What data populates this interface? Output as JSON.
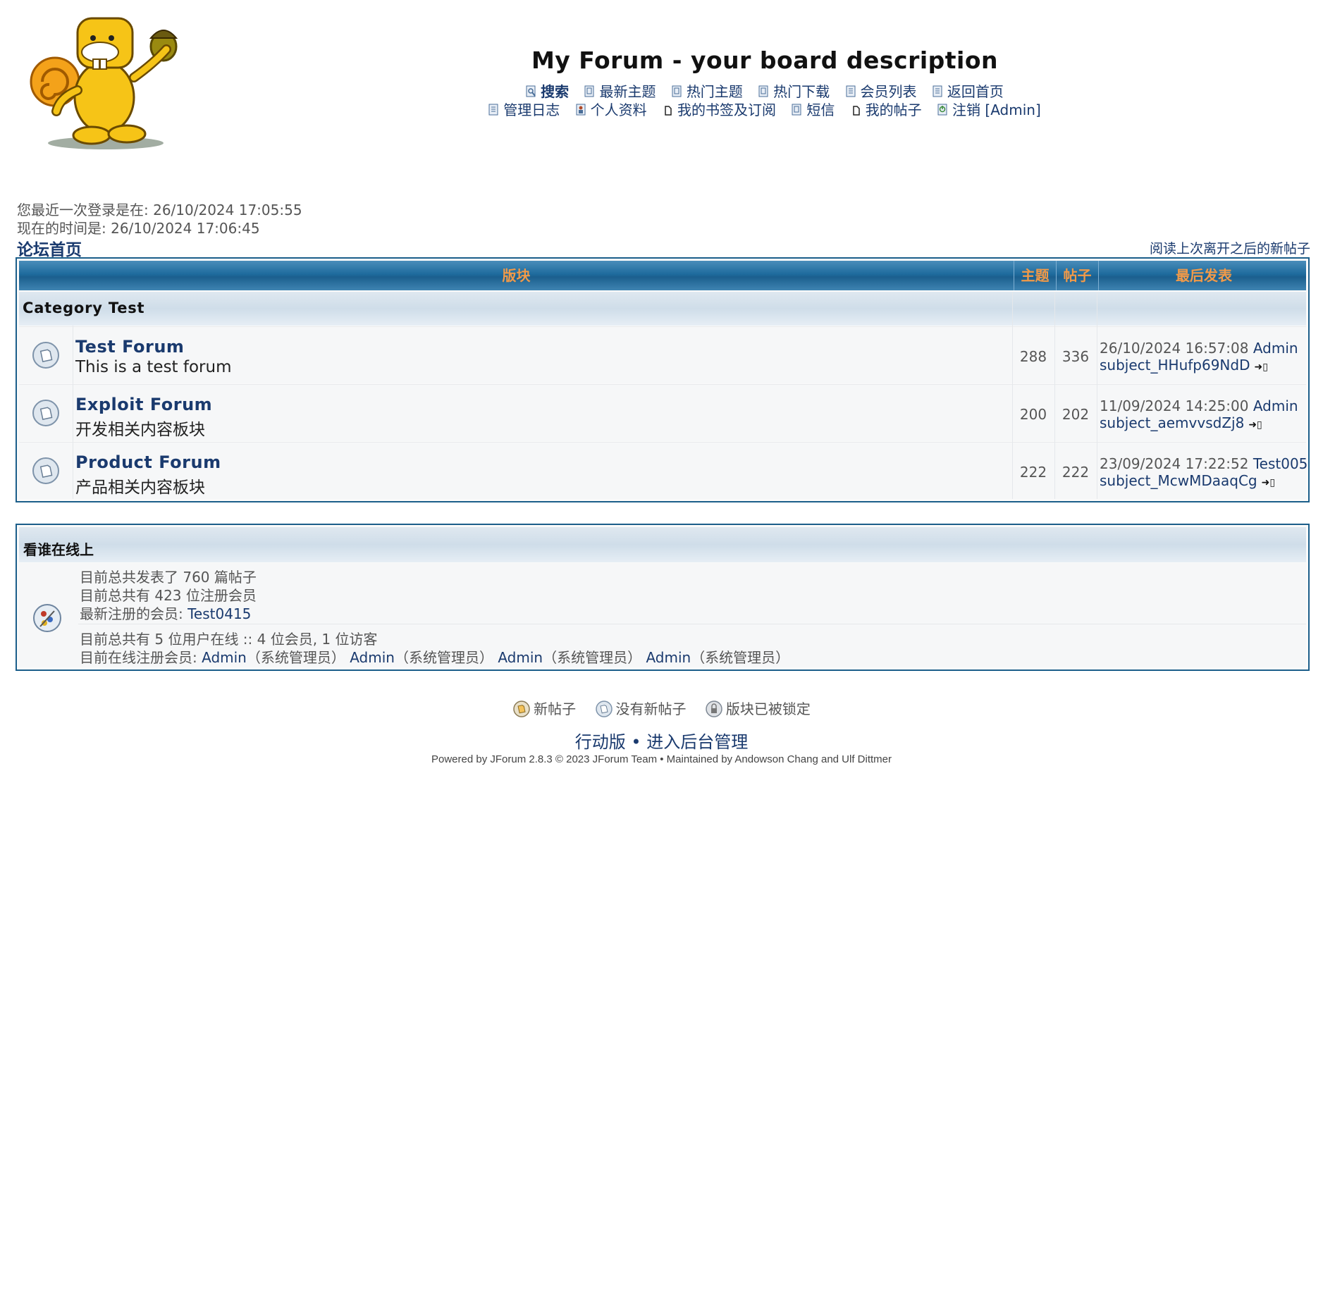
{
  "site": {
    "title": "My Forum - your board description",
    "logo_icon": "squirrel-logo-icon"
  },
  "nav": {
    "row1": [
      {
        "label": "搜索",
        "icon": "search-icon",
        "bold": true
      },
      {
        "label": "最新主题",
        "icon": "recent-topics-icon"
      },
      {
        "label": "热门主题",
        "icon": "hot-topics-icon"
      },
      {
        "label": "热门下载",
        "icon": "hot-downloads-icon"
      },
      {
        "label": "会员列表",
        "icon": "member-list-icon"
      },
      {
        "label": "返回首页",
        "icon": "home-icon"
      }
    ],
    "row2": [
      {
        "label": "管理日志",
        "icon": "moderation-log-icon"
      },
      {
        "label": "个人资料",
        "icon": "profile-icon"
      },
      {
        "label": "我的书签及订阅",
        "icon": "bookmarks-icon"
      },
      {
        "label": "短信",
        "icon": "private-messages-icon"
      },
      {
        "label": "我的帖子",
        "icon": "my-posts-icon"
      },
      {
        "label": "注销 [Admin]",
        "icon": "logout-icon"
      }
    ]
  },
  "session": {
    "last_visit": "您最近一次登录是在: 26/10/2024 17:05:55",
    "current_time": "现在的时间是: 26/10/2024 17:06:45"
  },
  "breadcrumb": "论坛首页",
  "since_last_visit_link": "阅读上次离开之后的新帖子",
  "forum_table": {
    "headers": {
      "forum": "版块",
      "topics": "主题",
      "posts": "帖子",
      "last_post": "最后发表"
    },
    "category": "Category Test",
    "forums": [
      {
        "name": "Test Forum",
        "desc": "This is a test forum",
        "topics": "288",
        "posts": "336",
        "last_date": "26/10/2024 16:57:08",
        "last_user": "Admin",
        "last_subject": "subject_HHufp69NdD"
      },
      {
        "name": "Exploit Forum",
        "desc": "开发相关内容板块",
        "topics": "200",
        "posts": "202",
        "last_date": "11/09/2024 14:25:00",
        "last_user": "Admin",
        "last_subject": "subject_aemvvsdZj8"
      },
      {
        "name": "Product Forum",
        "desc": "产品相关内容板块",
        "topics": "222",
        "posts": "222",
        "last_date": "23/09/2024 17:22:52",
        "last_user": "Test005",
        "last_subject": "subject_McwMDaaqCg"
      }
    ]
  },
  "online": {
    "title": "看谁在线上",
    "total_posts_prefix": "目前总共发表了",
    "total_posts": "760",
    "total_posts_suffix": "篇帖子",
    "total_users_prefix": "目前总共有",
    "total_users": "423",
    "total_users_suffix": "位注册会员",
    "newest_label": "最新注册的会员:",
    "newest_user": "Test0415",
    "online_summary": "目前总共有 5 位用户在线 :: 4 位会员, 1 位访客",
    "online_users_label": "目前在线注册会员:",
    "online_users": [
      {
        "name": "Admin",
        "role": "（系统管理员）"
      },
      {
        "name": "Admin",
        "role": "（系统管理员）"
      },
      {
        "name": "Admin",
        "role": "（系统管理员）"
      },
      {
        "name": "Admin",
        "role": "（系统管理员）"
      }
    ]
  },
  "legend": [
    {
      "label": "新帖子",
      "icon": "new-posts-folder-icon"
    },
    {
      "label": "没有新帖子",
      "icon": "no-new-posts-folder-icon"
    },
    {
      "label": "版块已被锁定",
      "icon": "locked-folder-icon"
    }
  ],
  "footer": {
    "mobile": "行动版",
    "sep": "•",
    "admin": "进入后台管理",
    "powered": "Powered by JForum 2.8.3 © 2023 JForum Team • Maintained by Andowson Chang and Ulf Dittmer"
  },
  "colors": {
    "header_bg": "#1b5f8e",
    "header_text": "#f29a48",
    "link": "#1a3a6e",
    "border": "#1b5e8a"
  }
}
